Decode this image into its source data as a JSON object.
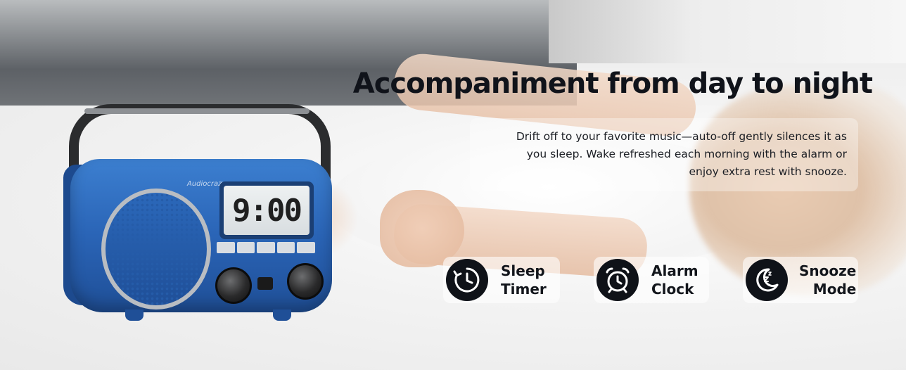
{
  "headline": "Accompaniment from day to night",
  "description": {
    "line1": "Drift off to your favorite music—auto-off gently silences it as",
    "line2": "you sleep. Wake refreshed each morning with the alarm or",
    "line3": "enjoy extra rest with snooze."
  },
  "radio": {
    "display_time": "9:00",
    "brand": "Audiocrazy"
  },
  "features": [
    {
      "icon": "sleep-timer-icon",
      "line1": "Sleep",
      "line2": "Timer"
    },
    {
      "icon": "alarm-clock-icon",
      "line1": "Alarm",
      "line2": "Clock"
    },
    {
      "icon": "snooze-moon-icon",
      "line1": "Snooze",
      "line2": "Mode"
    }
  ],
  "colors": {
    "radio_blue": "#2a64b6",
    "icon_circle": "#0f1218",
    "headline_text": "#10131a"
  }
}
